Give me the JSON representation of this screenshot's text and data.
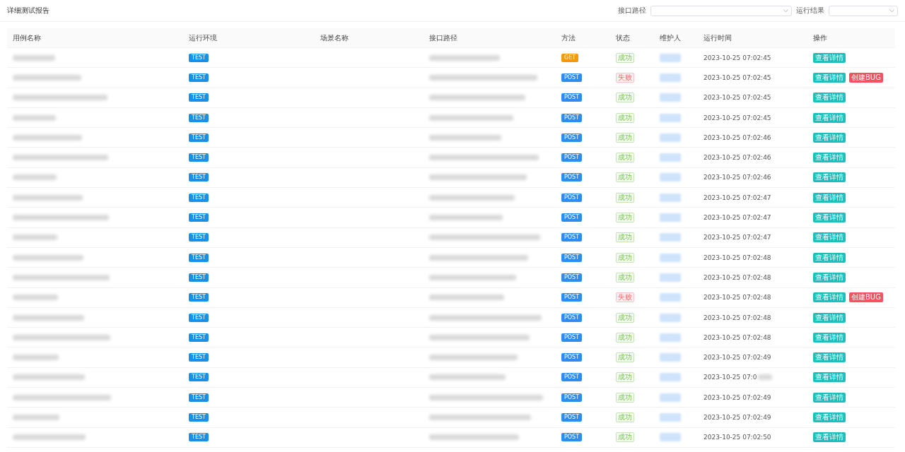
{
  "title": "详细测试报告",
  "filters": [
    {
      "label": "接口路径",
      "kind": "wide"
    },
    {
      "label": "运行结果",
      "kind": "narrow"
    }
  ],
  "columns": [
    "用例名称",
    "运行环境",
    "场景名称",
    "接口路径",
    "方法",
    "状态",
    "维护人",
    "运行时间",
    "操作"
  ],
  "rows": [
    {
      "env": "TEST",
      "method": "GET",
      "status": "成功",
      "passed": true,
      "time": "2023-10-25 07:02:45",
      "actions": [
        "查看详情"
      ]
    },
    {
      "env": "TEST",
      "method": "POST",
      "status": "失败",
      "passed": false,
      "time": "2023-10-25 07:02:45",
      "actions": [
        "查看详情",
        "创建BUG"
      ]
    },
    {
      "env": "TEST",
      "method": "POST",
      "status": "成功",
      "passed": true,
      "time": "2023-10-25 07:02:45",
      "actions": [
        "查看详情"
      ]
    },
    {
      "env": "TEST",
      "method": "POST",
      "status": "成功",
      "passed": true,
      "time": "2023-10-25 07:02:45",
      "actions": [
        "查看详情"
      ]
    },
    {
      "env": "TEST",
      "method": "POST",
      "status": "成功",
      "passed": true,
      "time": "2023-10-25 07:02:46",
      "actions": [
        "查看详情"
      ]
    },
    {
      "env": "TEST",
      "method": "POST",
      "status": "成功",
      "passed": true,
      "time": "2023-10-25 07:02:46",
      "actions": [
        "查看详情"
      ]
    },
    {
      "env": "TEST",
      "method": "POST",
      "status": "成功",
      "passed": true,
      "time": "2023-10-25 07:02:46",
      "actions": [
        "查看详情"
      ]
    },
    {
      "env": "TEST",
      "method": "POST",
      "status": "成功",
      "passed": true,
      "time": "2023-10-25 07:02:47",
      "actions": [
        "查看详情"
      ]
    },
    {
      "env": "TEST",
      "method": "POST",
      "status": "成功",
      "passed": true,
      "time": "2023-10-25 07:02:47",
      "actions": [
        "查看详情"
      ]
    },
    {
      "env": "TEST",
      "method": "POST",
      "status": "成功",
      "passed": true,
      "time": "2023-10-25 07:02:47",
      "actions": [
        "查看详情"
      ]
    },
    {
      "env": "TEST",
      "method": "POST",
      "status": "成功",
      "passed": true,
      "time": "2023-10-25 07:02:48",
      "actions": [
        "查看详情"
      ]
    },
    {
      "env": "TEST",
      "method": "POST",
      "status": "成功",
      "passed": true,
      "time": "2023-10-25 07:02:48",
      "actions": [
        "查看详情"
      ]
    },
    {
      "env": "TEST",
      "method": "POST",
      "status": "失败",
      "passed": false,
      "time": "2023-10-25 07:02:48",
      "actions": [
        "查看详情",
        "创建BUG"
      ]
    },
    {
      "env": "TEST",
      "method": "POST",
      "status": "成功",
      "passed": true,
      "time": "2023-10-25 07:02:48",
      "actions": [
        "查看详情"
      ]
    },
    {
      "env": "TEST",
      "method": "POST",
      "status": "成功",
      "passed": true,
      "time": "2023-10-25 07:02:48",
      "actions": [
        "查看详情"
      ]
    },
    {
      "env": "TEST",
      "method": "POST",
      "status": "成功",
      "passed": true,
      "time": "2023-10-25 07:02:49",
      "actions": [
        "查看详情"
      ]
    },
    {
      "env": "TEST",
      "method": "POST",
      "status": "成功",
      "passed": true,
      "time": "2023-10-25 07:0",
      "actions": [
        "查看详情"
      ]
    },
    {
      "env": "TEST",
      "method": "POST",
      "status": "成功",
      "passed": true,
      "time": "2023-10-25 07:02:49",
      "actions": [
        "查看详情"
      ]
    },
    {
      "env": "TEST",
      "method": "POST",
      "status": "成功",
      "passed": true,
      "time": "2023-10-25 07:02:49",
      "actions": [
        "查看详情"
      ]
    },
    {
      "env": "TEST",
      "method": "POST",
      "status": "成功",
      "passed": true,
      "time": "2023-10-25 07:02:50",
      "actions": [
        "查看详情"
      ]
    }
  ]
}
